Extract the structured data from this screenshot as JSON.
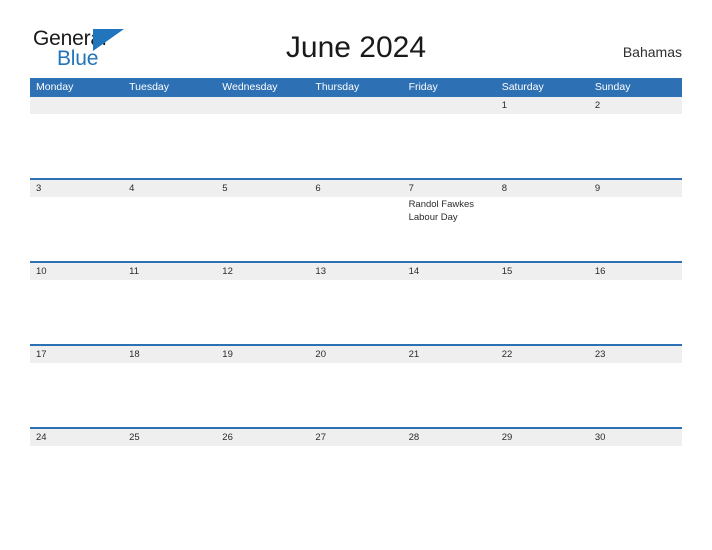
{
  "brand": {
    "name_primary": "General",
    "name_secondary": "Blue",
    "triangle_icon": "triangle-icon",
    "accent_color": "#2175bc"
  },
  "header": {
    "title": "June 2024",
    "country": "Bahamas"
  },
  "theme": {
    "header_blue": "#2e70b4",
    "row_band_gray": "#efefef",
    "text_dark": "#2b2b2b"
  },
  "calendar": {
    "weekdays": [
      "Monday",
      "Tuesday",
      "Wednesday",
      "Thursday",
      "Friday",
      "Saturday",
      "Sunday"
    ],
    "weeks": [
      {
        "days": [
          {
            "date": "",
            "events": []
          },
          {
            "date": "",
            "events": []
          },
          {
            "date": "",
            "events": []
          },
          {
            "date": "",
            "events": []
          },
          {
            "date": "",
            "events": []
          },
          {
            "date": "1",
            "events": []
          },
          {
            "date": "2",
            "events": []
          }
        ]
      },
      {
        "days": [
          {
            "date": "3",
            "events": []
          },
          {
            "date": "4",
            "events": []
          },
          {
            "date": "5",
            "events": []
          },
          {
            "date": "6",
            "events": []
          },
          {
            "date": "7",
            "events": [
              "Randol Fawkes Labour Day"
            ]
          },
          {
            "date": "8",
            "events": []
          },
          {
            "date": "9",
            "events": []
          }
        ]
      },
      {
        "days": [
          {
            "date": "10",
            "events": []
          },
          {
            "date": "11",
            "events": []
          },
          {
            "date": "12",
            "events": []
          },
          {
            "date": "13",
            "events": []
          },
          {
            "date": "14",
            "events": []
          },
          {
            "date": "15",
            "events": []
          },
          {
            "date": "16",
            "events": []
          }
        ]
      },
      {
        "days": [
          {
            "date": "17",
            "events": []
          },
          {
            "date": "18",
            "events": []
          },
          {
            "date": "19",
            "events": []
          },
          {
            "date": "20",
            "events": []
          },
          {
            "date": "21",
            "events": []
          },
          {
            "date": "22",
            "events": []
          },
          {
            "date": "23",
            "events": []
          }
        ]
      },
      {
        "days": [
          {
            "date": "24",
            "events": []
          },
          {
            "date": "25",
            "events": []
          },
          {
            "date": "26",
            "events": []
          },
          {
            "date": "27",
            "events": []
          },
          {
            "date": "28",
            "events": []
          },
          {
            "date": "29",
            "events": []
          },
          {
            "date": "30",
            "events": []
          }
        ]
      }
    ]
  }
}
